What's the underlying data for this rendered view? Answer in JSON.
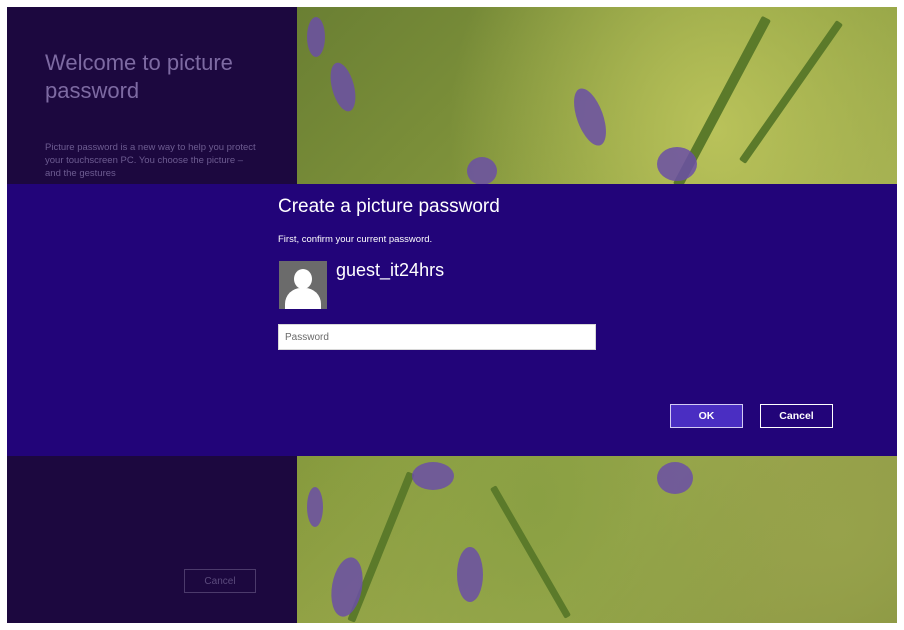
{
  "background": {
    "title": "Welcome to picture password",
    "description": "Picture password is a new way to help you protect your touchscreen PC. You choose the picture – and the gestures",
    "cancel_label": "Cancel"
  },
  "dialog": {
    "title": "Create a picture password",
    "subtitle": "First, confirm your current password.",
    "username": "guest_it24hrs",
    "password_placeholder": "Password",
    "password_value": "",
    "ok_label": "OK",
    "cancel_label": "Cancel"
  },
  "colors": {
    "band": "#220479",
    "left_panel": "#1c083f",
    "ok_button": "#4a2ec2"
  }
}
